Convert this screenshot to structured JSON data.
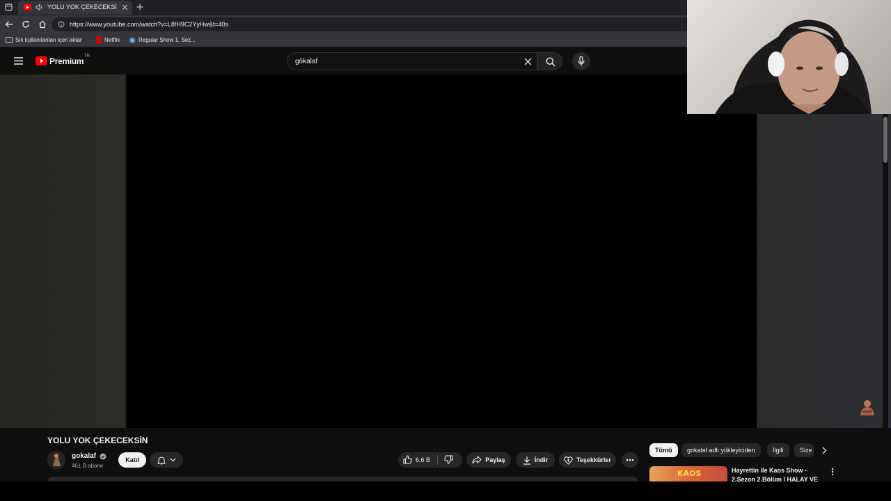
{
  "browser": {
    "tab_title": "YOLU YOK ÇEKECEKSİN - Yo",
    "url": "https://www.youtube.com/watch?v=L8fH9C2YyHw&t=40s",
    "bookmarks": [
      "Sık kullanılanları içeri aktar",
      "Netflix",
      "Regular Show 1. Sez..."
    ]
  },
  "youtube": {
    "logo_text": "Premium",
    "logo_region": "TR",
    "search_value": "gökalaf"
  },
  "video": {
    "title": "YOLU YOK ÇEKECEKSİN",
    "channel_name": "gokalaf",
    "subscribers": "461 B abone",
    "join_label": "Katıl",
    "like_count": "6,6 B",
    "share_label": "Paylaş",
    "download_label": "İndir",
    "thanks_label": "Teşekkürler"
  },
  "filters": [
    "Tümü",
    "gokalaf adlı yükleyiciden",
    "İlgili",
    "Size"
  ],
  "recommendation": {
    "title_line1": "Hayrettin ile Kaos Show -",
    "title_line2": "2.Sezon 2.Bölüm | HALAY VE",
    "thumb_text": "KAOS"
  },
  "colors": {
    "yt_red": "#ff0000",
    "background": "#0f0f0f",
    "chip_bg": "#272727",
    "chip_active_bg": "#f1f1f1"
  }
}
